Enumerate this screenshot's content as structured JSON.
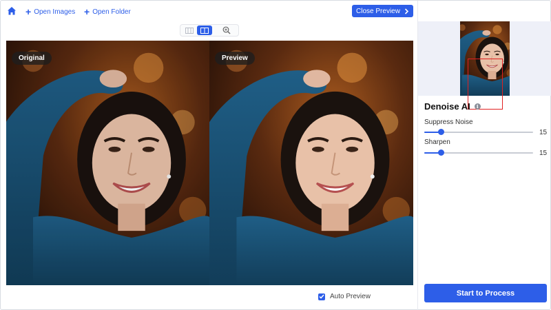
{
  "toolbar": {
    "home_icon": "home-icon",
    "open_images_label": "Open Images",
    "open_folder_label": "Open Folder",
    "close_preview_label": "Close Preview"
  },
  "view_modes": {
    "active": "split",
    "items": [
      "single-view-icon",
      "split-view-icon",
      "zoom-icon"
    ]
  },
  "panels": {
    "original_label": "Original",
    "preview_label": "Preview"
  },
  "auto_preview": {
    "label": "Auto Preview",
    "checked": true
  },
  "sidebar": {
    "title": "Denoise AI",
    "suppress_noise": {
      "label": "Suppress Noise",
      "value": "15",
      "fraction": 0.15
    },
    "sharpen": {
      "label": "Sharpen",
      "value": "15",
      "fraction": 0.15
    },
    "start_button_label": "Start to Process"
  },
  "colors": {
    "accent": "#2d5ee8",
    "navigator_frame": "#e02020",
    "sidebar_thumb_bg": "#eef0f8"
  }
}
